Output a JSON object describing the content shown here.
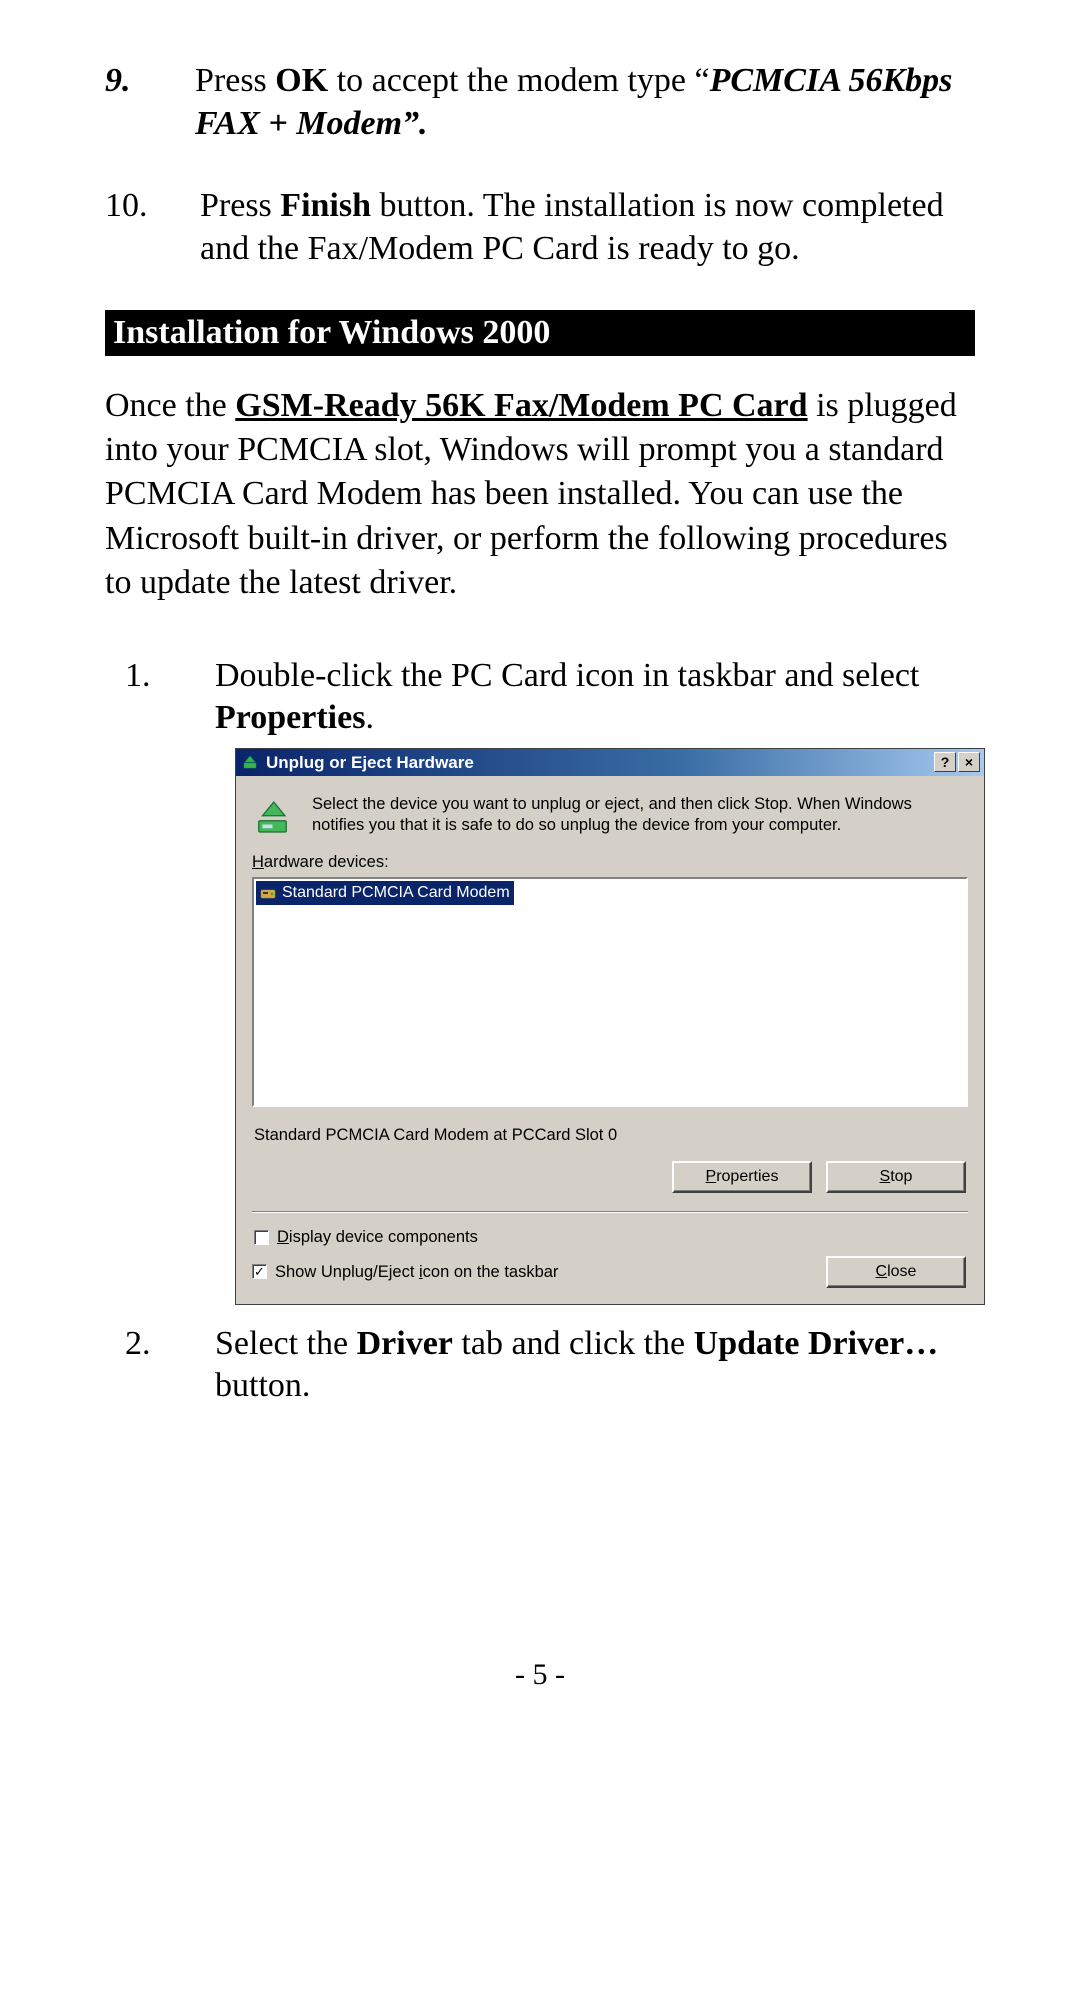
{
  "doc": {
    "steps_prev": [
      {
        "num": "9.",
        "plain1": "Press ",
        "bold1": "OK",
        "plain2": " to accept the modem type “",
        "bi1": "PCMCIA 56Kbps FAX + Modem”.",
        "plain3": ""
      },
      {
        "num": "10.",
        "plain1": "Press ",
        "bold1": "Finish",
        "plain2": " button.  The installation is now completed and the Fax/Modem PC Card is ready to go.",
        "bi1": "",
        "plain3": ""
      }
    ],
    "section_heading": "Installation for Windows 2000",
    "intro": {
      "pre": "Once the ",
      "underline_bold": "GSM-Ready 56K Fax/Modem PC Card",
      "post": " is plugged into your PCMCIA slot, Windows will prompt you a standard PCMCIA Card Modem has been installed.  You can use the Microsoft built-in driver, or perform the following procedures to update the latest driver."
    },
    "steps2000": {
      "s1": {
        "num": "1.",
        "pre": "Double-click the PC Card icon in taskbar and select ",
        "bold": "Properties",
        "post": "."
      },
      "s2": {
        "num": "2.",
        "pre": "Select the ",
        "bold1": "Driver",
        "mid": " tab and click the ",
        "bold2": "Update Driver…",
        "post": "button."
      }
    },
    "page_number": "- 5 -"
  },
  "dialog": {
    "title": "Unplug or Eject Hardware",
    "help_glyph": "?",
    "close_glyph": "×",
    "description": "Select the device you want to unplug or eject, and then click Stop. When Windows notifies you that it is safe to do so unplug the device from your computer.",
    "hw_label_pre": "H",
    "hw_label_rest": "ardware devices:",
    "selected_item": "Standard PCMCIA Card Modem",
    "status_line": "Standard PCMCIA Card Modem at PCCard Slot 0",
    "btn_properties_pre": "P",
    "btn_properties_rest": "roperties",
    "btn_stop_pre": "S",
    "btn_stop_rest": "top",
    "chk1_pre": "D",
    "chk1_rest": "isplay device components",
    "chk2_text_pre": "Show Unplug/Eject ",
    "chk2_mnemonic": "i",
    "chk2_text_post": "con on the taskbar",
    "chk2_checkmark": "✓",
    "btn_close_pre": "C",
    "btn_close_rest": "lose"
  }
}
